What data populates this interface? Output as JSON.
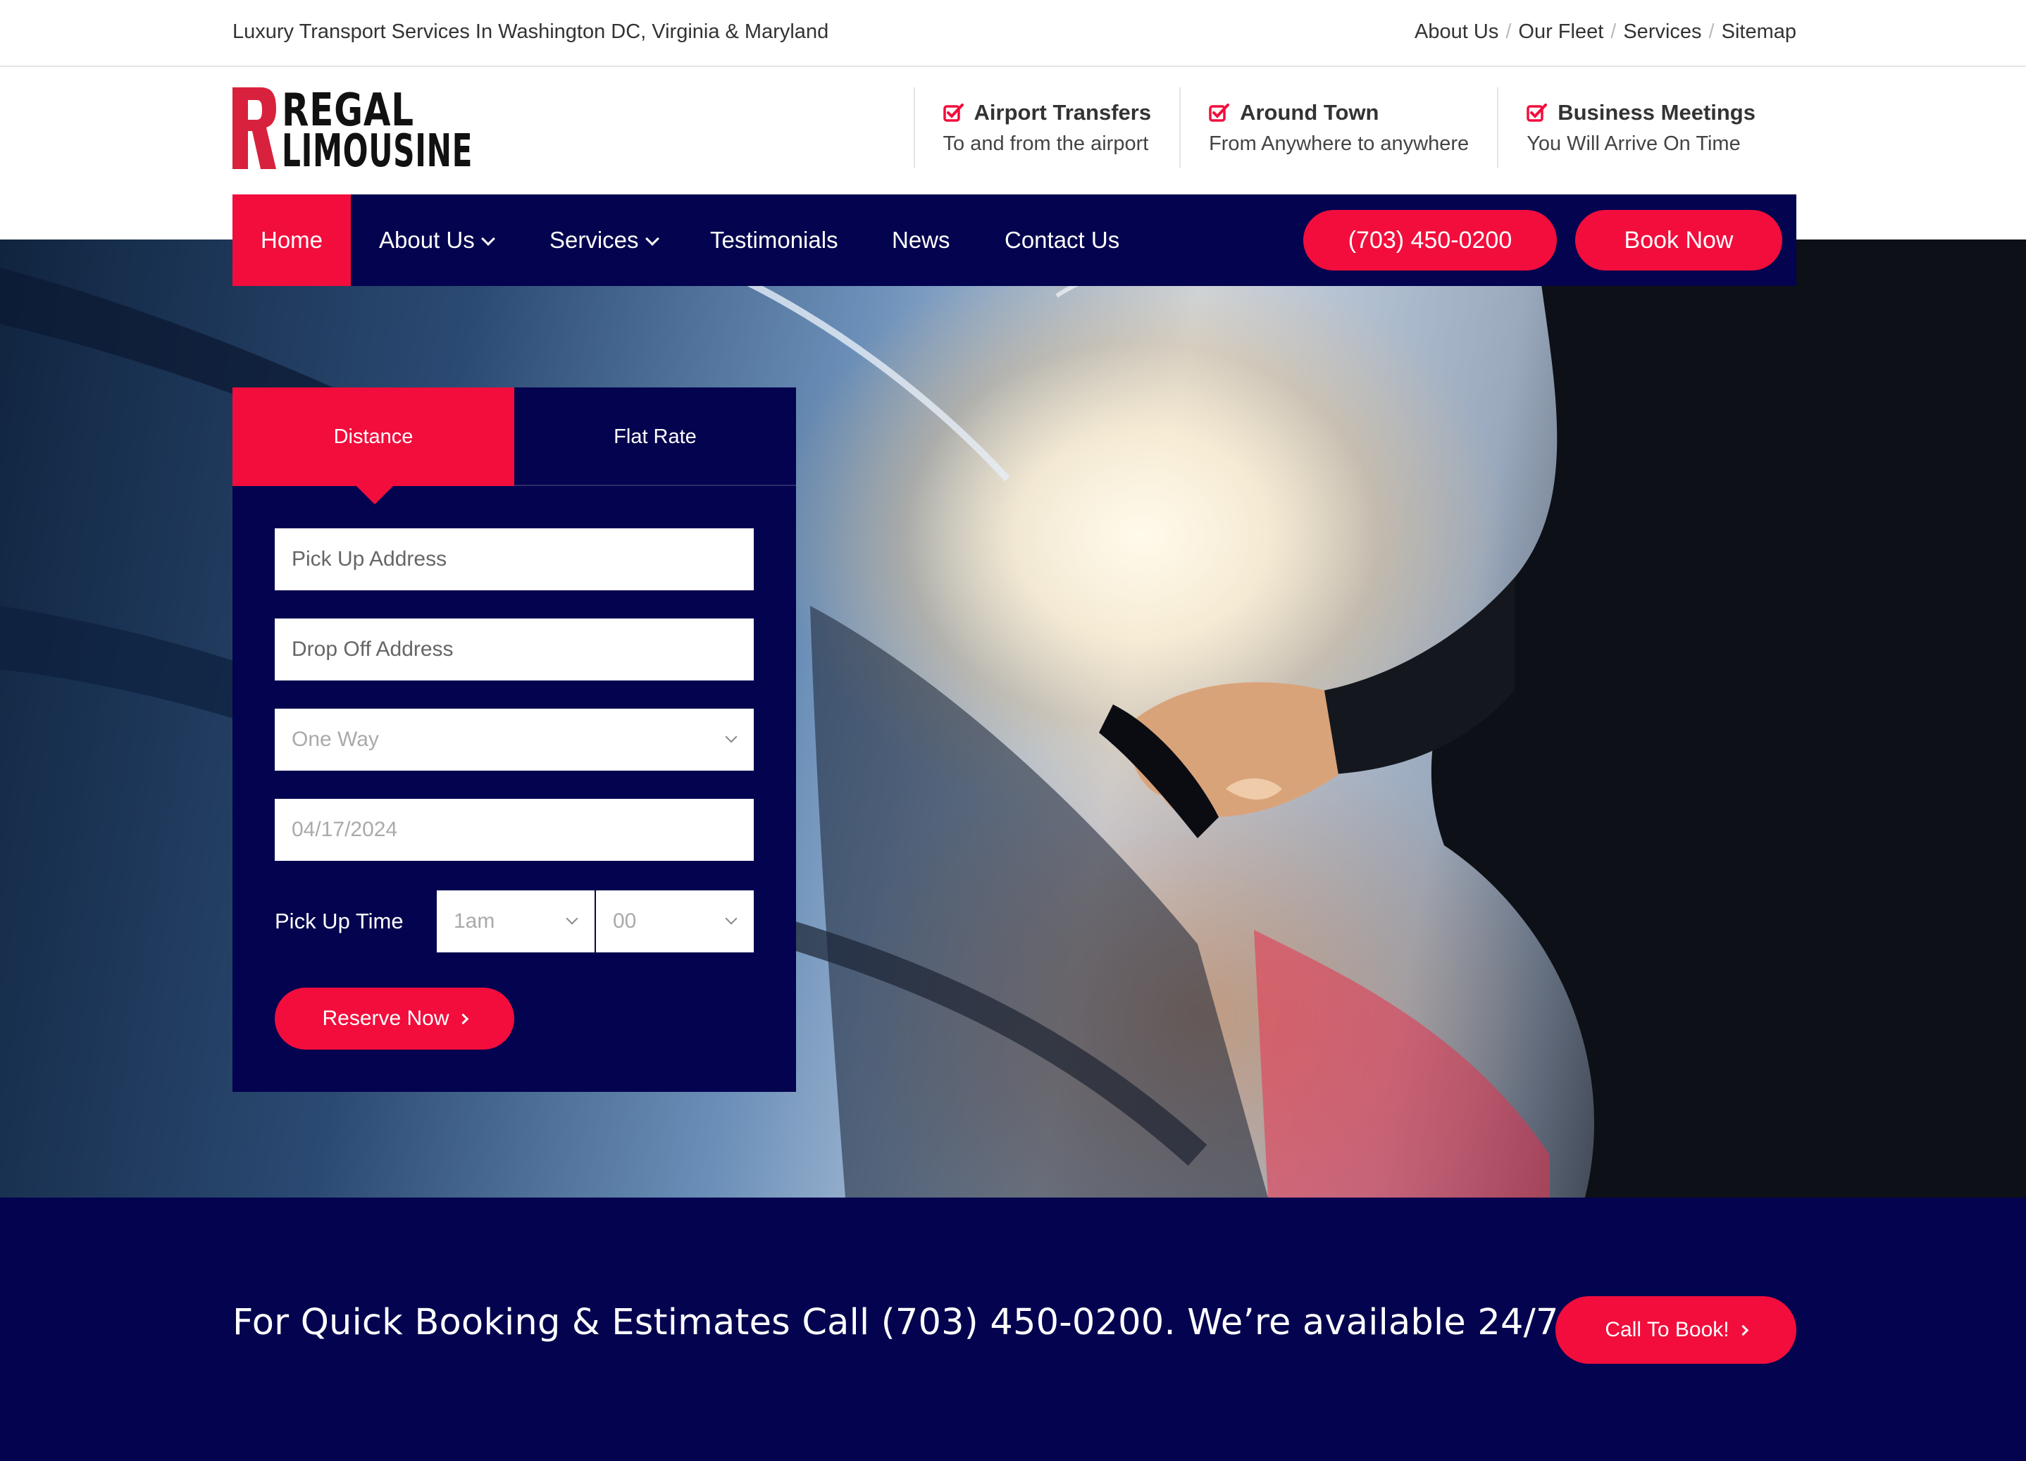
{
  "topbar": {
    "tagline": "Luxury Transport Services In Washington DC, Virginia & Maryland",
    "links": [
      "About Us",
      "Our Fleet",
      "Services",
      "Sitemap"
    ],
    "separator": "/"
  },
  "logo": {
    "initial": "R",
    "line1": "REGAL",
    "line2": "LIMOUSINE"
  },
  "features": [
    {
      "icon": "check-square-icon",
      "title": "Airport Transfers",
      "subtitle": "To and from the airport"
    },
    {
      "icon": "check-square-icon",
      "title": "Around Town",
      "subtitle": "From Anywhere to anywhere"
    },
    {
      "icon": "check-square-icon",
      "title": "Business Meetings",
      "subtitle": "You Will Arrive On Time"
    }
  ],
  "nav": {
    "items": [
      {
        "label": "Home",
        "active": true
      },
      {
        "label": "About Us",
        "dropdown": true
      },
      {
        "label": "Services",
        "dropdown": true
      },
      {
        "label": "Testimonials"
      },
      {
        "label": "News"
      },
      {
        "label": "Contact Us"
      }
    ],
    "phone": "(703) 450-0200",
    "book": "Book Now"
  },
  "booking": {
    "tabs": [
      "Distance",
      "Flat Rate"
    ],
    "active_tab": "Distance",
    "pickup_placeholder": "Pick Up Address",
    "dropoff_placeholder": "Drop Off Address",
    "trip_type": "One Way",
    "date": "04/17/2024",
    "time_label": "Pick Up Time",
    "hour": "1am",
    "minute": "00",
    "submit": "Reserve Now"
  },
  "cta": {
    "message": "For Quick Booking & Estimates Call (703) 450-0200. We’re available 24/7!",
    "button": "Call To Book!"
  },
  "colors": {
    "accent": "#f20d3c",
    "navy": "#03034f",
    "text": "#333333"
  }
}
